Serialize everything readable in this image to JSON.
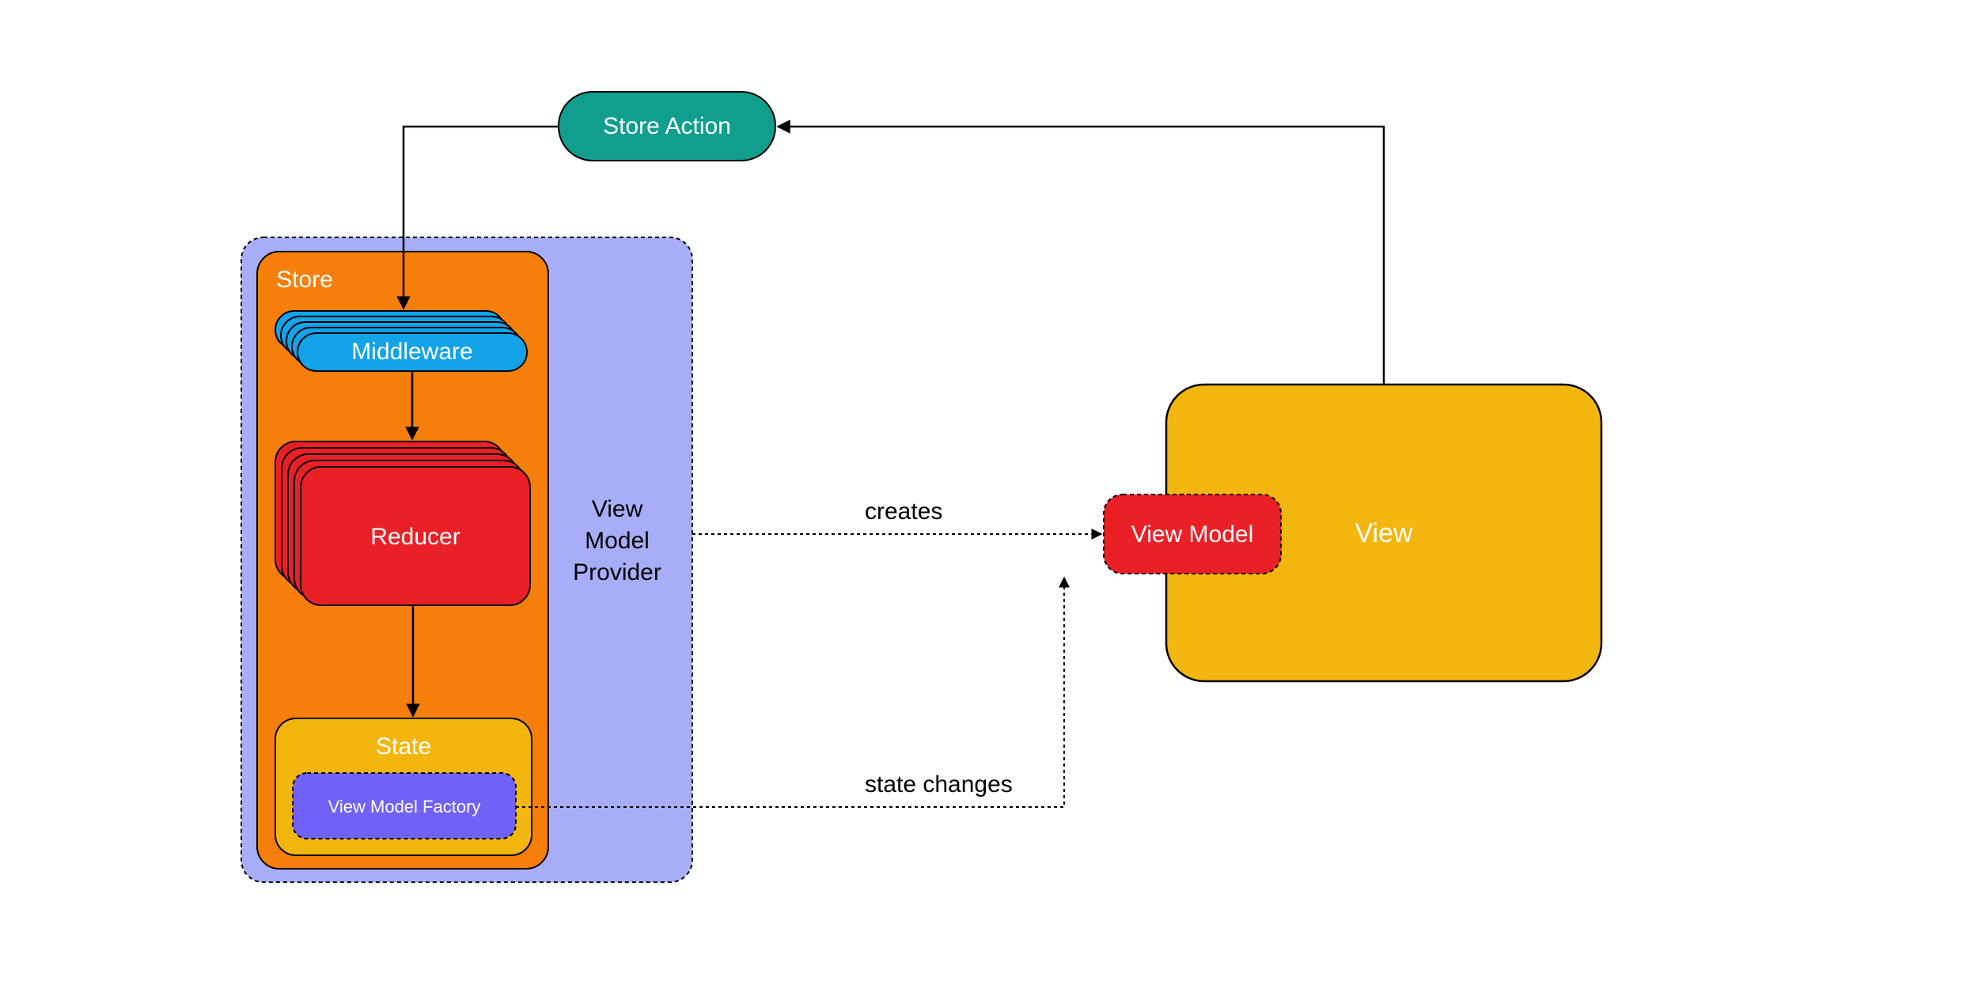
{
  "nodes": {
    "store_action": "Store Action",
    "store": "Store",
    "middleware": "Middleware",
    "reducer": "Reducer",
    "state": "State",
    "view_model_factory": "View Model Factory",
    "view_model_provider_l1": "View",
    "view_model_provider_l2": "Model",
    "view_model_provider_l3": "Provider",
    "view_model": "View Model",
    "view": "View"
  },
  "edges": {
    "creates": "creates",
    "state_changes": "state changes"
  },
  "colors": {
    "teal": "#119e8e",
    "lavender": "#a7aef7",
    "orange": "#f67f0b",
    "blue": "#13a3e9",
    "red": "#eb2027",
    "amber": "#f3b60e",
    "purple": "#7062f6",
    "black": "#000000",
    "white": "#ffffff"
  }
}
